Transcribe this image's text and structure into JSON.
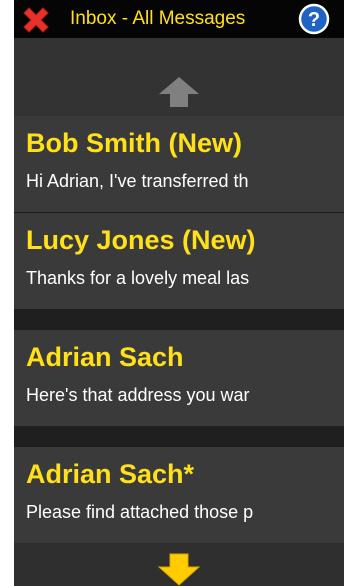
{
  "header": {
    "title": "Inbox - All Messages",
    "close_icon": "close-x-icon",
    "help_icon": "help-question-icon"
  },
  "colors": {
    "accent": "#ffe01a",
    "close_red": "#e8312a",
    "help_blue": "#1f63c4",
    "up_arrow": "#808080",
    "down_arrow": "#ffcc00"
  },
  "messages": [
    {
      "sender": "Bob Smith (New)",
      "preview": "Hi Adrian, I've transferred th"
    },
    {
      "sender": "Lucy Jones (New)",
      "preview": "Thanks for a lovely meal las"
    },
    {
      "sender": "Adrian Sach",
      "preview": "Here's that address you war"
    },
    {
      "sender": "Adrian Sach*",
      "preview": "Please find attached those p"
    }
  ],
  "scroll": {
    "up_icon": "arrow-up-icon",
    "down_icon": "arrow-down-icon"
  }
}
